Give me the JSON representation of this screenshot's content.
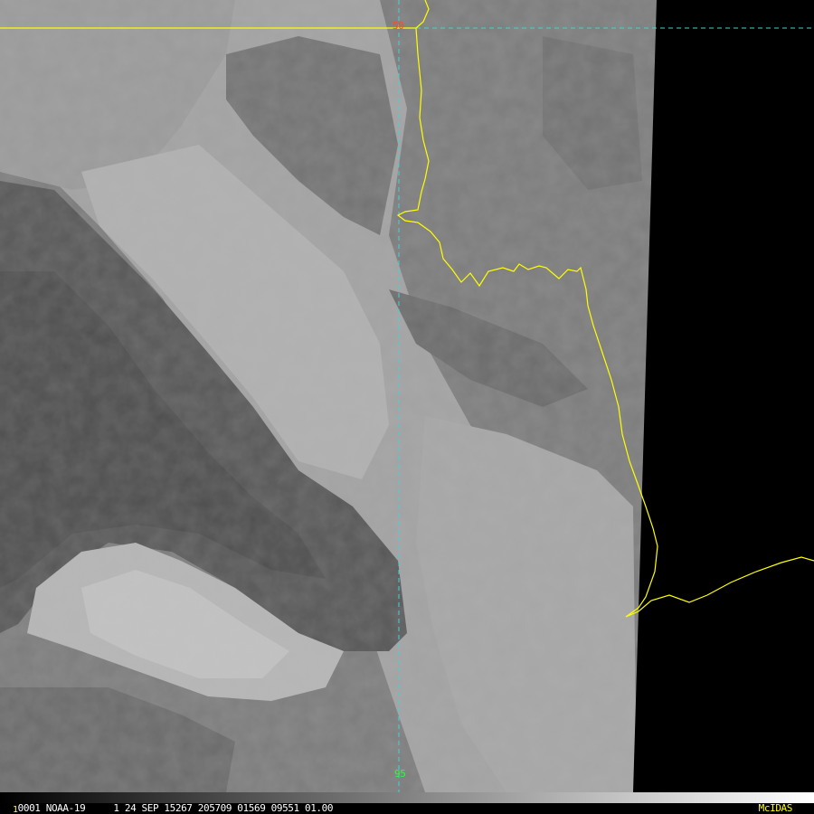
{
  "map": {
    "latitude_label": "50",
    "longitude_label": "95",
    "colors": {
      "coastline": "#ffff00",
      "graticule": "#3fd4d4",
      "latitude_label": "#ff4b2b",
      "longitude_label": "#23ff3c"
    }
  },
  "status_bar": {
    "frame_number": "1",
    "image_info": "0001 NOAA-19     1 24 SEP 15267 205709 01569 09551 01.00",
    "brand": "McIDAS",
    "brand_color": "#ffff00"
  }
}
